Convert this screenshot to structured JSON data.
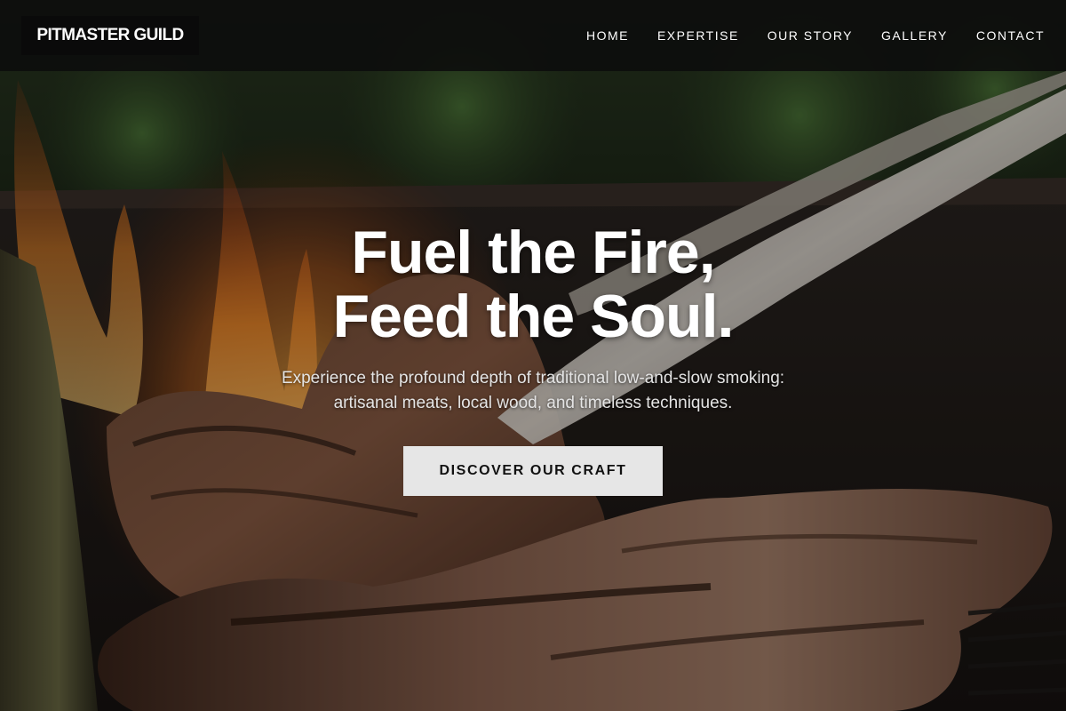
{
  "brand": {
    "name": "PITMASTER GUILD"
  },
  "nav": {
    "items": [
      {
        "label": "HOME"
      },
      {
        "label": "EXPERTISE"
      },
      {
        "label": "OUR STORY"
      },
      {
        "label": "GALLERY"
      },
      {
        "label": "CONTACT"
      }
    ]
  },
  "hero": {
    "title_line1": "Fuel the Fire,",
    "title_line2": "Feed the Soul.",
    "subtitle_line1": "Experience the profound depth of traditional low-and-slow smoking:",
    "subtitle_line2": "artisanal meats, local wood, and timeless techniques.",
    "cta_label": "DISCOVER OUR CRAFT",
    "background_image": "grilled-steak-over-open-flame-photo"
  },
  "colors": {
    "navbar_bg": "#0c0c0c",
    "logo_bg": "#0a0a0a",
    "cta_bg": "#e6e6e6",
    "text_light": "#ffffff",
    "flame": "#e8711c"
  }
}
